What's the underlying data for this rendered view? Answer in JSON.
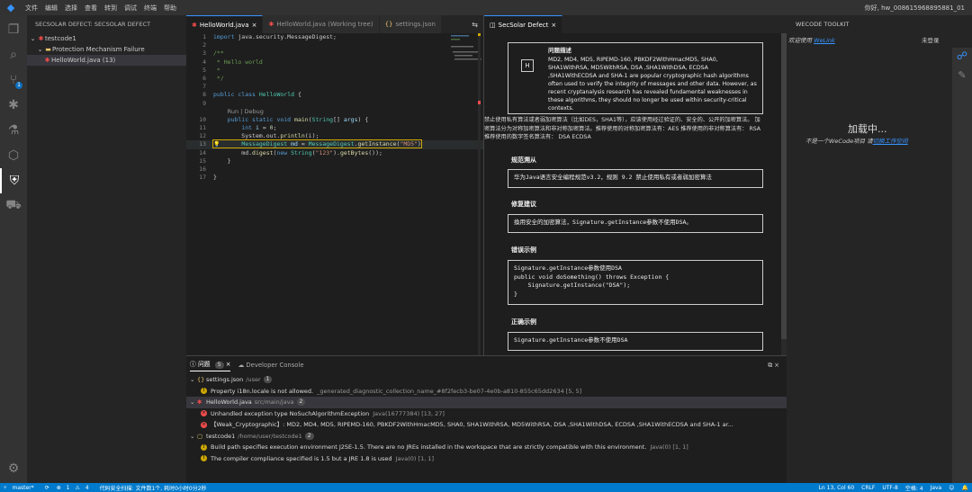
{
  "titlebar": {
    "menus": [
      "文件",
      "编辑",
      "选择",
      "查看",
      "转到",
      "调试",
      "终端",
      "帮助"
    ],
    "user": "你好, hw_008615968895881_01"
  },
  "activity": {
    "scm_badge": "1"
  },
  "sidebar": {
    "title": "SECSOLAR DEFECT: SECSOLAR DEFECT",
    "tree": [
      {
        "label": "testcode1",
        "level": 0
      },
      {
        "label": "Protection Mechanism Failure",
        "level": 1
      },
      {
        "label": "HelloWorld.java (13)",
        "level": 2
      }
    ]
  },
  "editor": {
    "tabs": [
      {
        "label": "HelloWorld.java",
        "active": true
      },
      {
        "label": "HelloWorld.java (Working tree)",
        "active": false
      },
      {
        "label": "settings.json",
        "active": false
      }
    ],
    "lines": [
      {
        "n": "1",
        "html": "<span class=\"kw\">import</span> java.security.MessageDigest;"
      },
      {
        "n": "2",
        "html": ""
      },
      {
        "n": "3",
        "html": "<span class=\"cm\">/**</span>"
      },
      {
        "n": "4",
        "html": "<span class=\"cm\"> * Hello world</span>"
      },
      {
        "n": "5",
        "html": "<span class=\"cm\"> *</span>"
      },
      {
        "n": "6",
        "html": "<span class=\"cm\"> */</span>"
      },
      {
        "n": "7",
        "html": ""
      },
      {
        "n": "8",
        "html": "<span class=\"kw\">public class</span> <span class=\"ty\">HelloWorld</span> {"
      },
      {
        "n": "9",
        "html": ""
      },
      {
        "n": "",
        "html": "    <span style=\"color:#999;font-family:'DejaVu Sans',sans-serif\">Run | Debug</span>"
      },
      {
        "n": "10",
        "html": "    <span class=\"kw\">public static void</span> <span class=\"fn\">main</span>(<span class=\"ty\">String</span>[] <span class=\"va\">args</span>) {"
      },
      {
        "n": "11",
        "html": "        <span class=\"kw\">int</span> <span class=\"va\">i</span> = <span class=\"nm\">0</span>;"
      },
      {
        "n": "12",
        "html": "        System.out.<span class=\"fn\">println</span>(i);"
      },
      {
        "n": "13",
        "html": "        <span class=\"ty\">MessageDigest</span> <span class=\"va\">md</span> = <span class=\"ty\">MessageDigest</span>.<span class=\"fn\">getInstance</span>(<span class=\"st\">\"MD5\"</span>)"
      },
      {
        "n": "14",
        "html": "        md.<span class=\"fn\">digest</span>(<span class=\"kw\">new</span> <span class=\"ty\">String</span>(<span class=\"st\">\"123\"</span>).<span class=\"fn\">getBytes</span>());"
      },
      {
        "n": "15",
        "html": "    }"
      },
      {
        "n": "16",
        "html": ""
      },
      {
        "n": "17",
        "html": "}"
      }
    ]
  },
  "secsolar": {
    "tab": "SecSolar Defect",
    "desc_title": "问题描述",
    "desc_body": "MD2, MD4, MD5, RIPEMD-160, PBKDF2WithHmacMD5, SHA0, SHA1WithRSA, MD5WithRSA, DSA ,SHA1WithDSA, ECDSA ,SHA1WithECDSA and SHA-1 are popular cryptographic hash algorithms often used to verify the integrity of messages and other data. However, as recent cryptanalysis research has revealed fundamental weaknesses in these algorithms, they should no longer be used within security-critical contexts.",
    "desc_cn": "禁止使用私有算法或者弱加密算法（比如DES，SHA1等），应该使用经过验证的、安全的、公开的加密算法。 加密算法分为对称加密算法和非对称加密算法。推荐使用的对称加密算法有：AES 推荐使用的非对称算法有： RSA 推荐使用的数字签名算法有： DSA ECDSA",
    "spec_title": "规范溯从",
    "spec_body": "华为Java语言安全编程规范v3.2，规则 9.2 禁止使用私有或者弱加密算法",
    "fix_title": "修复建议",
    "fix_body": "換用安全的加密算法，Signature.getInstance参数不使用DSA。",
    "bad_title": "错误示例",
    "bad_lines": [
      "Signature.getInstance参数使用DSA",
      "public void doSomething() throws Exception {",
      "    Signature.getInstance(\"DSA\");",
      "}"
    ],
    "good_title": "正确示例",
    "good_body": "Signature.getInstance参数不使用DSA"
  },
  "wecode": {
    "title": "WECODE TOOLKIT",
    "welcome": "欢迎使用",
    "welcome_link": "WeLink",
    "login": "未登录",
    "loading": "加载中...",
    "not_project": "不是一个WeCode项目 请",
    "switch_link": "切换工作空间"
  },
  "problems": {
    "tab_label": "问题",
    "tab_count": "5",
    "console_label": "Developer Console",
    "groups": [
      {
        "file": "settings.json",
        "path": "/user",
        "count": "1",
        "items": [
          {
            "sev": "warn",
            "text": "Property i18n.locale is not allowed.",
            "detail": "_generated_diagnostic_collection_name_#8f2fecb3-be07-4e0b-a810-855c65dd2634 [5, 5]"
          }
        ]
      },
      {
        "file": "HelloWorld.java",
        "path": "src/main/java",
        "count": "2",
        "items": [
          {
            "sev": "err",
            "text": "Unhandled exception type NoSuchAlgorithmException",
            "detail": "Java(16777384) [13, 27]"
          },
          {
            "sev": "err",
            "text": "【Weak_Cryptographic】: MD2, MD4, MD5, RIPEMD-160, PBKDF2WithHmacMD5, SHA0, SHA1WithRSA, MD5WithRSA, DSA ,SHA1WithDSA, ECDSA ,SHA1WithECDSA and SHA-1 ar...",
            "detail": ""
          }
        ]
      },
      {
        "file": "testcode1",
        "path": "/home/user/testcode1",
        "count": "2",
        "items": [
          {
            "sev": "warn",
            "text": "Build path specifies execution environment J2SE-1.5. There are no JREs installed in the workspace that are strictly compatible with this environment.",
            "detail": "Java(0) [1, 1]"
          },
          {
            "sev": "warn",
            "text": "The compiler compliance specified is 1.5 but a JRE 1.8 is used",
            "detail": "Java(0) [1, 1]"
          }
        ]
      }
    ]
  },
  "status": {
    "branch": "master*",
    "errors": "1",
    "warnings": "4",
    "scan": "代码安全扫描: 文件数1个, 耗时0小时0分2秒",
    "position": "Ln 13, Col 60",
    "eol": "CRLF",
    "encoding": "UTF-8",
    "spaces": "空格: 4",
    "lang": "Java"
  }
}
